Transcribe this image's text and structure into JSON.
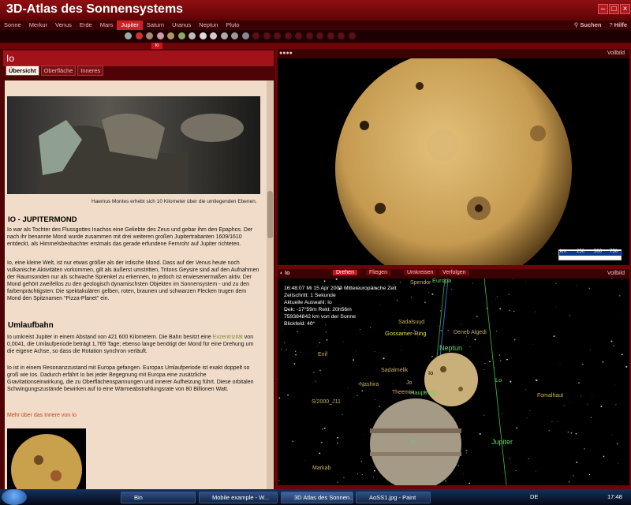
{
  "app": {
    "title": "3D-Atlas des Sonnensystems"
  },
  "planets": [
    "Sonne",
    "Merkur",
    "Venus",
    "Erde",
    "Mars",
    "Jupiter",
    "Saturn",
    "Uranus",
    "Neptun",
    "Pluto"
  ],
  "active_planet": "Jupiter",
  "search_label": "Suchen",
  "help_label": "Hilfe",
  "moon_tag": "Io",
  "panel": {
    "title": "Io",
    "tabs": [
      "Übersicht",
      "Oberfläche",
      "Inneres"
    ]
  },
  "article": {
    "caption": "Haemus Montes erhebt sich 10 Kilometer über die umliegenden Ebenen.",
    "heading1": "IO - JUPITERMOND",
    "p1": "Io war als Tochter des Flussgottes Inachos eine Geliebte des Zeus und gebar ihm den Epaphos. Der nach ihr benannte Mond wurde zusammen mit drei weiteren großen Jupitertrabanten 1609/1610 entdeckt, als Himmelsbeobachter erstmals das gerade erfundene Fernrohr auf Jupiter richteten.",
    "p2": "Io, eine kleine Welt, ist nur etwas größer als der irdische Mond. Dass auf der Venus heute noch vulkanische Aktivitäten vorkommen, gilt als äußerst umstritten, Tritons Geysire sind auf den Aufnahmen der Raumsonden nur als schwache Sprenkel zu erkennen, Io jedoch ist erwiesenermaßen aktiv. Der Mond gehört zweifellos zu den geologisch dynamischsten Objekten im Sonnensystem - und zu den farbenprächtigsten: Die spektakulären gelben, roten, braunen und schwarzen Flecken trugen dem Mond den Spitznamen \"Pizza-Planet\" ein.",
    "heading2": "Umlaufbahn",
    "p3_a": "Io umkreist Jupiter in einem Abstand von 421 600 Kilometern. Die Bahn besitzt eine",
    "p3_link": "Exzentrizität",
    "p3_b": "von 0,0041, die Umlaufperiode beträgt 1,769 Tage; ebenso lange benötigt der Mond für eine Drehung um die eigene Achse, so dass die Rotation synchron verläuft.",
    "p4": "Io ist in einem Resonanzzustand mit Europa gefangen. Europas Umlaufperiode ist exakt doppelt so groß wie Ios. Dadurch erfährt Io bei jeder Begegnung mit Europa eine zusätzliche Gravitationseinwirkung, die zu Oberflächenspannungen und innerer Aufheizung führt. Diese orbitalen Schwingungszustände bewirken auf Io eine Wärmeabstrahlungsrate von 80 Billionen Watt.",
    "more": "Mehr über das Innere von Io"
  },
  "view_top": {
    "vollbild": "Vollbild",
    "scale": {
      "unit": "km",
      "ticks": [
        "250",
        "500",
        "750"
      ]
    }
  },
  "view_bottom": {
    "target": "Io",
    "buttons": [
      "Drehen",
      "Fliegen",
      "Umkreisen",
      "Verfolgen"
    ],
    "vollbild": "Vollbild",
    "info": [
      "16:48:07 Mi    15 Apr  2009 Mitteleuropäische Zeit",
      "Zeitschritt: 1 Sekunde",
      "Aktuelle Auswahl: Io",
      "Dek: -17°59m Rekt: 20h56m",
      "759384842 km von der Sonne",
      "Blickfeld: 40°"
    ],
    "labels_green": [
      "Europa",
      "Gossamer-Ring",
      "Neptun",
      "Io",
      "Jupiter",
      "Lo",
      "Hauptring",
      "Io"
    ],
    "labels_star": [
      "Spendor",
      "Sadalsuud",
      "Deneb Algedi",
      "Enif",
      "Sadalmelik",
      "Nashira",
      "Fomalhaut",
      "Markab",
      "Jo",
      "Theemin",
      "S/2000_J11"
    ]
  },
  "taskbar": {
    "items": [
      "Bin",
      "Mobile example - W...",
      "3D Atlas des Sonnen...",
      "AoSS1.jpg - Paint"
    ],
    "lang": "DE",
    "clock": "17:48"
  },
  "colors": {
    "accent": "#c5161d",
    "panel_bg": "#f0dcc8",
    "link": "#7a8c3a"
  }
}
